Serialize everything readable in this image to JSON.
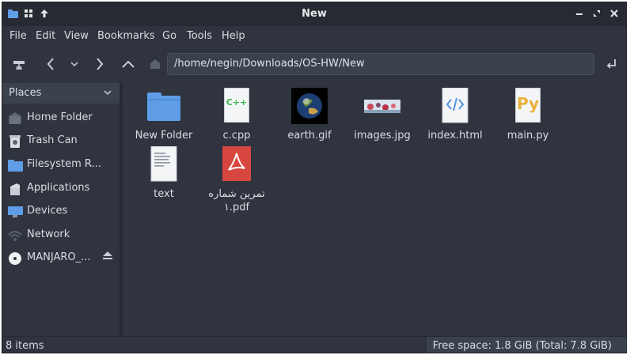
{
  "window": {
    "title": "New"
  },
  "menu": [
    "File",
    "Edit",
    "View",
    "Bookmarks",
    "Go",
    "Tools",
    "Help"
  ],
  "toolbar": {
    "path": "/home/negin/Downloads/OS-HW/New"
  },
  "sidebar": {
    "header": "Places",
    "items": [
      {
        "label": "Home Folder",
        "icon": "home-folder-icon"
      },
      {
        "label": "Trash Can",
        "icon": "trash-icon"
      },
      {
        "label": "Filesystem R...",
        "icon": "filesystem-folder-icon"
      },
      {
        "label": "Applications",
        "icon": "applications-icon"
      },
      {
        "label": "Devices",
        "icon": "monitor-icon"
      },
      {
        "label": "Network",
        "icon": "network-icon"
      },
      {
        "label": "MANJARO_...",
        "icon": "disc-icon"
      }
    ]
  },
  "files": [
    {
      "name": "New Folder",
      "icon": "folder-icon"
    },
    {
      "name": "c.cpp",
      "icon": "cpp-file-icon",
      "badge": "C++"
    },
    {
      "name": "earth.gif",
      "icon": "earth-image-icon"
    },
    {
      "name": "images.jpg",
      "icon": "image-thumbnail-icon"
    },
    {
      "name": "index.html",
      "icon": "html-file-icon"
    },
    {
      "name": "main.py",
      "icon": "python-file-icon",
      "badge": "Py"
    },
    {
      "name": "text",
      "icon": "text-file-icon"
    },
    {
      "name": "تمرین شماره ۱.pdf",
      "icon": "pdf-file-icon"
    }
  ],
  "status": {
    "count": "8 items",
    "free_space": "Free space: 1.8 GiB (Total: 7.8 GiB)"
  },
  "colors": {
    "background": "#2f343f",
    "folder": "#5f9ee6",
    "pdf": "#d7463f",
    "accent": "#5294e2"
  }
}
